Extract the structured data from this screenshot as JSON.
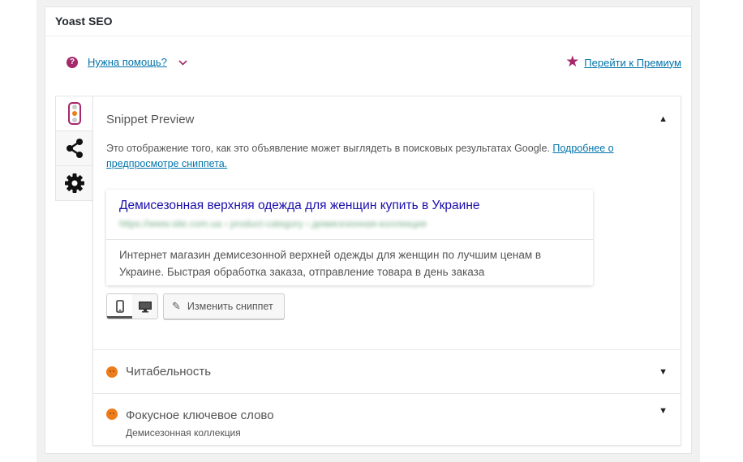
{
  "metabox": {
    "title": "Yoast SEO"
  },
  "help": {
    "label": "Нужна помощь?",
    "icon": "?"
  },
  "premium": {
    "label": "Перейти к Премиум"
  },
  "tabs": [
    {
      "name": "seo-tab",
      "icon": "traffic-light-icon"
    },
    {
      "name": "social-tab",
      "icon": "share-icon"
    },
    {
      "name": "settings-tab",
      "icon": "gear-icon"
    }
  ],
  "snippet_preview": {
    "title": "Snippet Preview",
    "description": "Это отображение того, как это объявление может выглядеть в поисковых результатах Google.",
    "link": "Подробнее о предпросмотре сниппета.",
    "result_title": "Демисезонная верхняя одежда для женщин купить в Украине",
    "result_url": "https://www.site.com.ua › product-category › демисезонная-коллекция",
    "result_description": "Интернет магазин демисезонной верхней одежды для женщин по лучшим ценам в Украине. Быстрая обработка заказа, отправление товара в день заказа",
    "edit_label": "Изменить сниппет"
  },
  "readability": {
    "title": "Читабельность"
  },
  "focus_keyword": {
    "title": "Фокусное ключевое слово",
    "value": "Демисезонная коллекция"
  },
  "colors": {
    "accent": "#a4286a",
    "link": "#0073aa",
    "status_ok": "#ee7c1b",
    "google_title": "#1a0dab"
  }
}
